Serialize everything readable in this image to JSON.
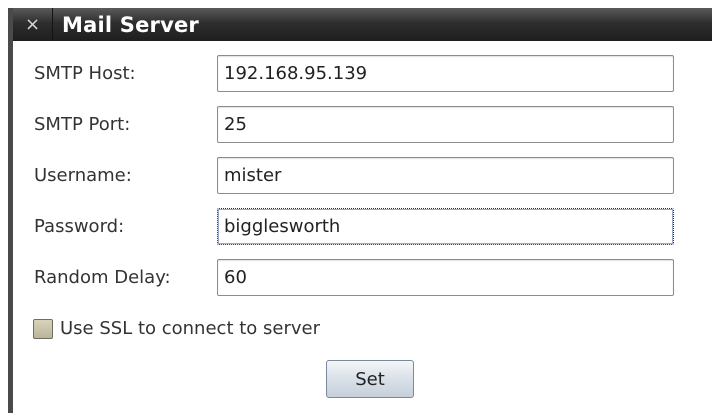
{
  "dialog": {
    "title": "Mail Server",
    "close_glyph": "×",
    "close_icon": "close-icon"
  },
  "form": {
    "fields": [
      {
        "label": "SMTP Host:",
        "value": "192.168.95.139"
      },
      {
        "label": "SMTP Port:",
        "value": "25"
      },
      {
        "label": "Username:",
        "value": "mister"
      },
      {
        "label": "Password:",
        "value": "bigglesworth"
      },
      {
        "label": "Random Delay:",
        "value": "60"
      }
    ],
    "ssl": {
      "label": "Use SSL to connect to server",
      "checked": false
    },
    "submit_label": "Set"
  },
  "colors": {
    "titlebar": "#2e2e2e",
    "title_text": "#ffffff",
    "checkbox_fill": "#c8c3a8",
    "button_border": "#7a8a9e"
  }
}
